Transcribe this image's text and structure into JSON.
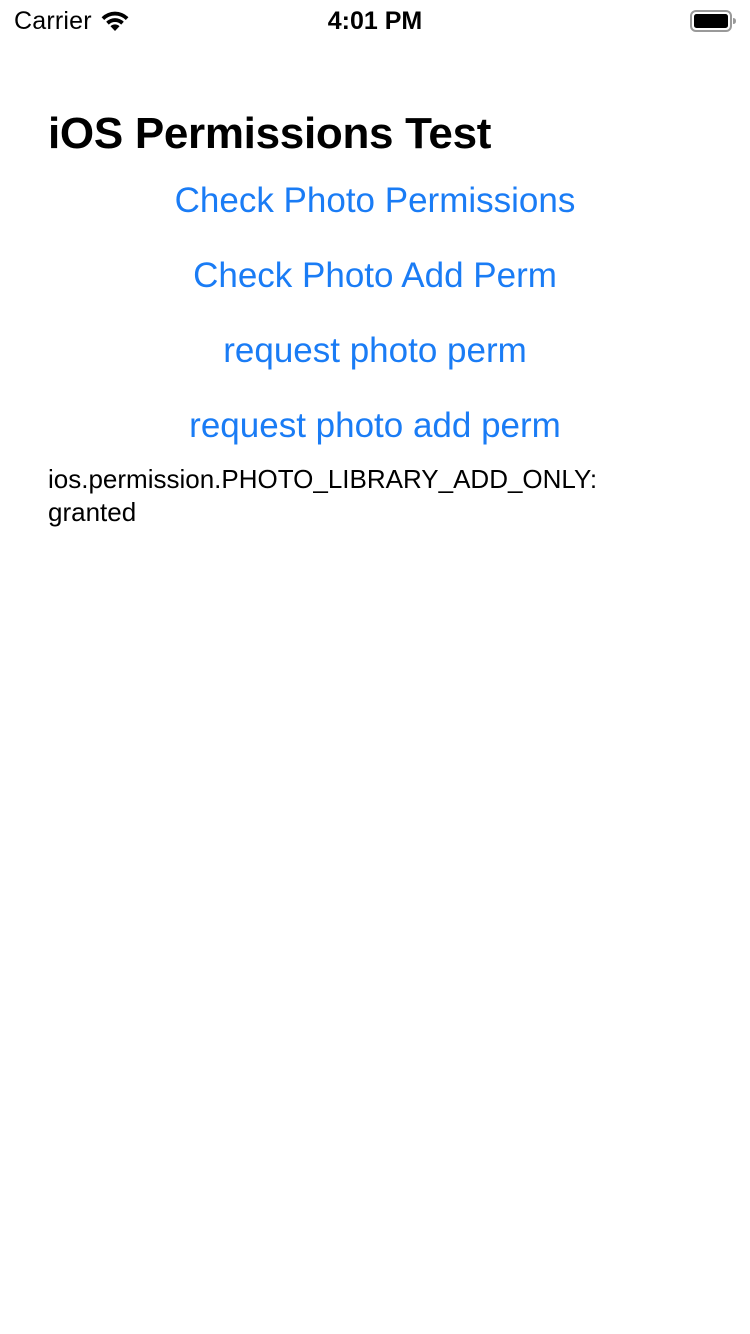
{
  "status_bar": {
    "carrier": "Carrier",
    "time": "4:01 PM",
    "icons": [
      "wifi-icon",
      "battery-icon"
    ]
  },
  "main": {
    "title": "iOS Permissions Test",
    "buttons": [
      {
        "label": "Check Photo Permissions"
      },
      {
        "label": "Check Photo Add Perm"
      },
      {
        "label": "request photo perm"
      },
      {
        "label": "request photo add perm"
      }
    ],
    "result_text": "ios.permission.PHOTO_LIBRARY_ADD_ONLY:\ngranted"
  },
  "colors": {
    "accent": "#1a7cf5",
    "text": "#000000",
    "background": "#ffffff"
  }
}
